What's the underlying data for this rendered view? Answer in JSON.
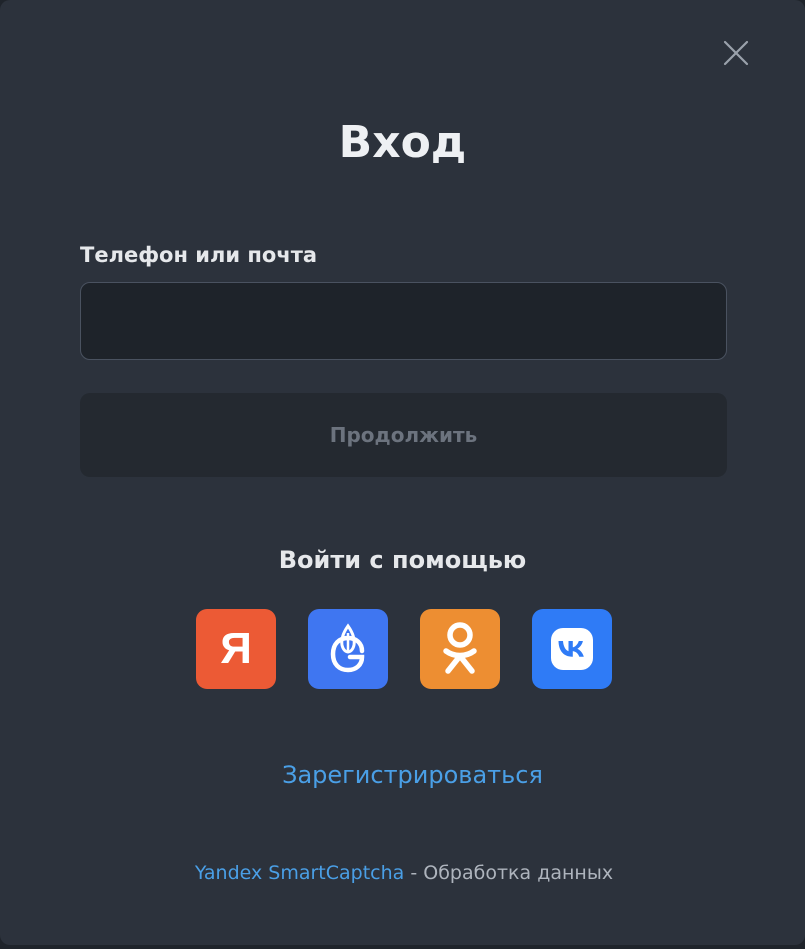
{
  "modal": {
    "title": "Вход",
    "close_icon": "close-icon"
  },
  "login_form": {
    "field_label": "Телефон или почта",
    "input_value": "",
    "input_placeholder": "",
    "continue_label": "Продолжить"
  },
  "social": {
    "heading": "Войти с помощью",
    "providers": [
      {
        "name": "yandex",
        "icon": "yandex-icon",
        "color": "#ec5a35",
        "glyph": "Я"
      },
      {
        "name": "gazprom",
        "icon": "gazprom-id-icon",
        "color": "#3f76f1"
      },
      {
        "name": "odnoklassniki",
        "icon": "odnoklassniki-icon",
        "color": "#ed8e32"
      },
      {
        "name": "vk",
        "icon": "vk-icon",
        "color": "#2f7bf6"
      }
    ]
  },
  "register": {
    "label": "Зарегистрироваться"
  },
  "footer": {
    "captcha_label": "Yandex SmartCaptcha",
    "separator": " - ",
    "processing_label": "Обработка данных"
  },
  "colors": {
    "background": "#2c323c",
    "input_background": "#1e232a",
    "button_disabled": "#242930",
    "link": "#4a9fe6",
    "text": "#e6e8eb"
  }
}
